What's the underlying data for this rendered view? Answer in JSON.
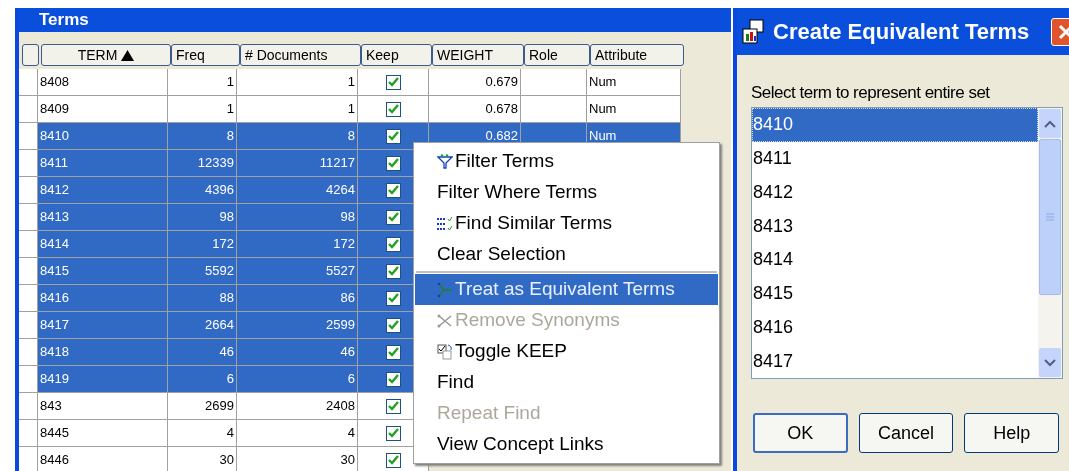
{
  "terms_window": {
    "title": "Terms",
    "columns": [
      {
        "label": "TERM",
        "sorted": true,
        "sort_ascending": true
      },
      {
        "label": "Freq"
      },
      {
        "label": "# Documents"
      },
      {
        "label": "Keep"
      },
      {
        "label": "WEIGHT"
      },
      {
        "label": "Role"
      },
      {
        "label": "Attribute"
      }
    ],
    "rows": [
      {
        "term": "8408",
        "freq": "1",
        "documents": "1",
        "keep": true,
        "weight": "0.679",
        "attribute": "Num",
        "selected": false
      },
      {
        "term": "8409",
        "freq": "1",
        "documents": "1",
        "keep": true,
        "weight": "0.678",
        "attribute": "Num",
        "selected": false
      },
      {
        "term": "8410",
        "freq": "8",
        "documents": "8",
        "keep": true,
        "weight": "0.682",
        "attribute": "Num",
        "selected": true
      },
      {
        "term": "8411",
        "freq": "12339",
        "documents": "11217",
        "keep": true,
        "selected": true
      },
      {
        "term": "8412",
        "freq": "4396",
        "documents": "4264",
        "keep": true,
        "selected": true
      },
      {
        "term": "8413",
        "freq": "98",
        "documents": "98",
        "keep": true,
        "selected": true
      },
      {
        "term": "8414",
        "freq": "172",
        "documents": "172",
        "keep": true,
        "selected": true
      },
      {
        "term": "8415",
        "freq": "5592",
        "documents": "5527",
        "keep": true,
        "selected": true
      },
      {
        "term": "8416",
        "freq": "88",
        "documents": "86",
        "keep": true,
        "selected": true
      },
      {
        "term": "8417",
        "freq": "2664",
        "documents": "2599",
        "keep": true,
        "selected": true
      },
      {
        "term": "8418",
        "freq": "46",
        "documents": "46",
        "keep": true,
        "selected": true
      },
      {
        "term": "8419",
        "freq": "6",
        "documents": "6",
        "keep": true,
        "selected": true
      },
      {
        "term": "843",
        "freq": "2699",
        "documents": "2408",
        "keep": true,
        "selected": false
      },
      {
        "term": "8445",
        "freq": "4",
        "documents": "4",
        "keep": true,
        "selected": false
      },
      {
        "term": "8446",
        "freq": "30",
        "documents": "30",
        "keep": true,
        "selected": false
      }
    ]
  },
  "context_menu": [
    {
      "kind": "item",
      "label": "Filter Terms",
      "disabled": false,
      "selected": false
    },
    {
      "kind": "item",
      "label": "Filter Where Terms",
      "disabled": false,
      "selected": false
    },
    {
      "kind": "item",
      "label": "Find Similar Terms",
      "disabled": false,
      "selected": false
    },
    {
      "kind": "item",
      "label": "Clear Selection",
      "disabled": false,
      "selected": false
    },
    {
      "kind": "separator"
    },
    {
      "kind": "item",
      "label": "Treat as Equivalent Terms",
      "disabled": false,
      "selected": true
    },
    {
      "kind": "item",
      "label": "Remove Synonyms",
      "disabled": true,
      "selected": false
    },
    {
      "kind": "item",
      "label": "Toggle KEEP",
      "disabled": false,
      "selected": false
    },
    {
      "kind": "item",
      "label": "Find",
      "disabled": false,
      "selected": false
    },
    {
      "kind": "item",
      "label": "Repeat Find",
      "disabled": true,
      "selected": false
    },
    {
      "kind": "item",
      "label": "View Concept Links",
      "disabled": false,
      "selected": false
    }
  ],
  "dialog": {
    "title": "Create Equivalent Terms",
    "prompt": "Select term to represent entire set",
    "list": [
      {
        "label": "8410",
        "selected": true
      },
      {
        "label": "8411",
        "selected": false
      },
      {
        "label": "8412",
        "selected": false
      },
      {
        "label": "8413",
        "selected": false
      },
      {
        "label": "8414",
        "selected": false
      },
      {
        "label": "8415",
        "selected": false
      },
      {
        "label": "8416",
        "selected": false
      },
      {
        "label": "8417",
        "selected": false
      }
    ],
    "buttons": [
      {
        "label": "OK",
        "default": true
      },
      {
        "label": "Cancel",
        "default": false
      },
      {
        "label": "Help",
        "default": false
      }
    ]
  }
}
